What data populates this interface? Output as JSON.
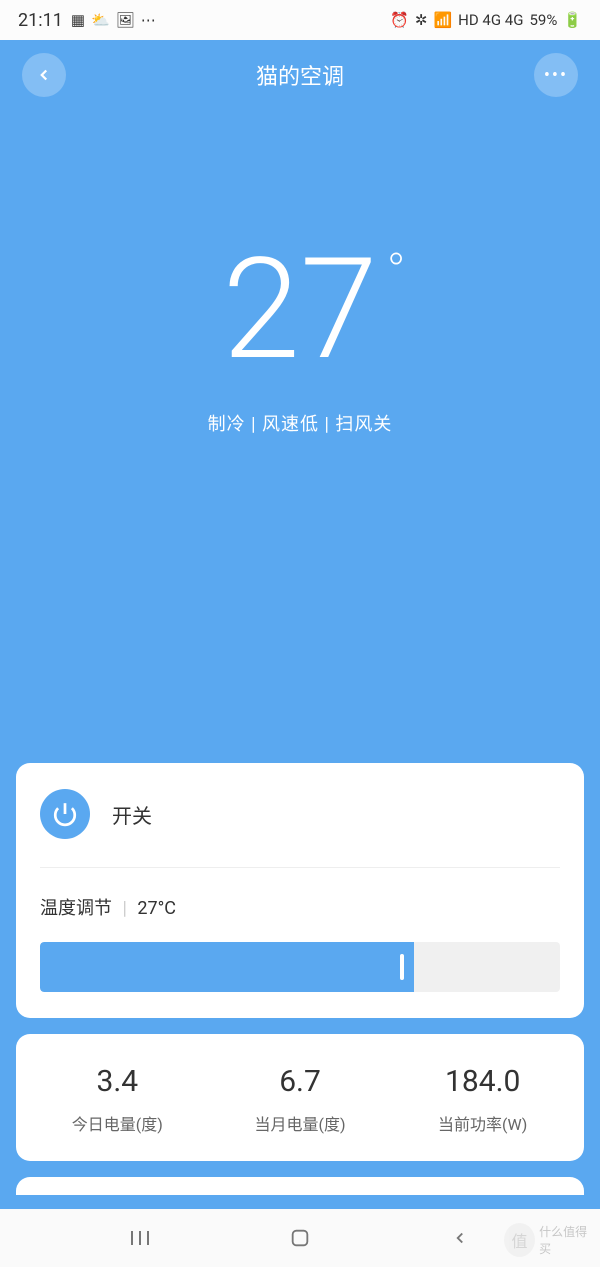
{
  "statusBar": {
    "time": "21:11",
    "battery": "59%",
    "signal": "HD 4G 4G"
  },
  "header": {
    "title": "猫的空调"
  },
  "temperature": {
    "value": "27",
    "degree": "°",
    "modeStatus": "制冷 | 风速低 | 扫风关"
  },
  "controls": {
    "powerLabel": "开关",
    "tempAdjust": {
      "label": "温度调节",
      "value": "27°C",
      "sliderPercent": 72
    }
  },
  "stats": {
    "todayEnergy": {
      "value": "3.4",
      "label": "今日电量(度)"
    },
    "monthEnergy": {
      "value": "6.7",
      "label": "当月电量(度)"
    },
    "currentPower": {
      "value": "184.0",
      "label": "当前功率(W)"
    }
  },
  "watermark": {
    "char": "值",
    "text": "什么值得买"
  }
}
